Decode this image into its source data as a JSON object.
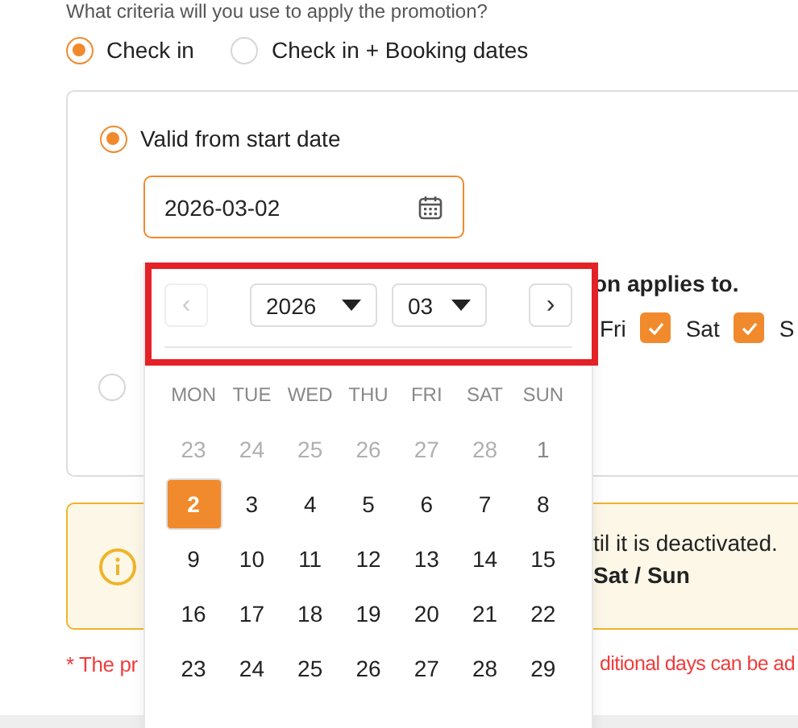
{
  "question": "What criteria will you use to apply the promotion?",
  "criteria": [
    {
      "label": "Check in",
      "selected": true
    },
    {
      "label": "Check in + Booking dates",
      "selected": false
    }
  ],
  "validity_options": [
    {
      "label": "Valid from start date",
      "selected": true
    },
    {
      "selected": false
    }
  ],
  "start_date": {
    "value": "2026-03-02"
  },
  "days_heading_fragment": "on applies to.",
  "weekdays": [
    {
      "label": "Fri"
    },
    {
      "label": "Sat",
      "checked": true
    },
    {
      "label": "S",
      "checked": true
    }
  ],
  "info": {
    "line_1": "til it is deactivated.",
    "line_2": "Sat / Sun"
  },
  "note": [
    "* The pr",
    "ditional days can be ad"
  ],
  "calendar": {
    "prev": "‹",
    "prev_disabled": true,
    "next": "›",
    "year": "2026",
    "month": "03",
    "weekdays": [
      "MON",
      "TUE",
      "WED",
      "THU",
      "FRI",
      "SAT",
      "SUN"
    ],
    "days": [
      {
        "label": "23",
        "kind": "other-month",
        "selected": false
      },
      {
        "label": "24",
        "kind": "other-month",
        "selected": false
      },
      {
        "label": "25",
        "kind": "other-month",
        "selected": false
      },
      {
        "label": "26",
        "kind": "other-month",
        "selected": false
      },
      {
        "label": "27",
        "kind": "other-month",
        "selected": false
      },
      {
        "label": "28",
        "kind": "other-month",
        "selected": false
      },
      {
        "label": "1",
        "kind": "inactive",
        "selected": false
      },
      {
        "label": "2",
        "kind": "day",
        "selected": true
      },
      {
        "label": "3",
        "kind": "day",
        "selected": false
      },
      {
        "label": "4",
        "kind": "day",
        "selected": false
      },
      {
        "label": "5",
        "kind": "day",
        "selected": false
      },
      {
        "label": "6",
        "kind": "day",
        "selected": false
      },
      {
        "label": "7",
        "kind": "day",
        "selected": false
      },
      {
        "label": "8",
        "kind": "day",
        "selected": false
      },
      {
        "label": "9",
        "kind": "day",
        "selected": false
      },
      {
        "label": "10",
        "kind": "day",
        "selected": false
      },
      {
        "label": "11",
        "kind": "day",
        "selected": false
      },
      {
        "label": "12",
        "kind": "day",
        "selected": false
      },
      {
        "label": "13",
        "kind": "day",
        "selected": false
      },
      {
        "label": "14",
        "kind": "day",
        "selected": false
      },
      {
        "label": "15",
        "kind": "day",
        "selected": false
      },
      {
        "label": "16",
        "kind": "day",
        "selected": false
      },
      {
        "label": "17",
        "kind": "day",
        "selected": false
      },
      {
        "label": "18",
        "kind": "day",
        "selected": false
      },
      {
        "label": "19",
        "kind": "day",
        "selected": false
      },
      {
        "label": "20",
        "kind": "day",
        "selected": false
      },
      {
        "label": "21",
        "kind": "day",
        "selected": false
      },
      {
        "label": "22",
        "kind": "day",
        "selected": false
      },
      {
        "label": "23",
        "kind": "day",
        "selected": false
      },
      {
        "label": "24",
        "kind": "day",
        "selected": false
      },
      {
        "label": "25",
        "kind": "day",
        "selected": false
      },
      {
        "label": "26",
        "kind": "day",
        "selected": false
      },
      {
        "label": "27",
        "kind": "day",
        "selected": false
      },
      {
        "label": "28",
        "kind": "day",
        "selected": false
      },
      {
        "label": "29",
        "kind": "day",
        "selected": false
      }
    ]
  },
  "annotation": {
    "kind": "highlight-frame"
  }
}
